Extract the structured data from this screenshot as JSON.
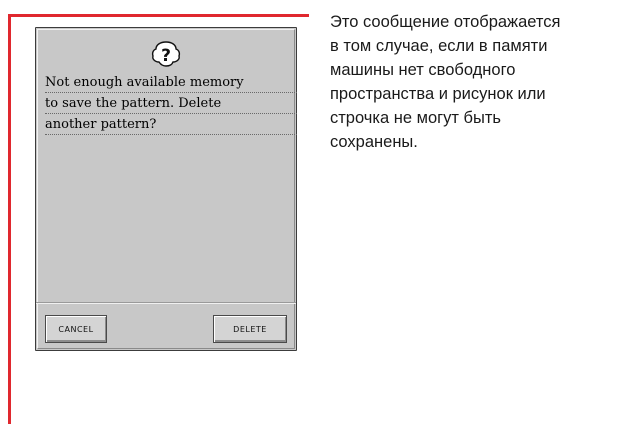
{
  "dialog": {
    "icon": "question-mark-icon",
    "message_lines": [
      "Not enough available memory",
      "to save the pattern. Delete",
      "another pattern?"
    ],
    "cancel_label": "CANCEL",
    "delete_label": "DELETE"
  },
  "description": {
    "lines": [
      "Это сообщение отображается",
      "в том случае, если в памяти",
      "машины нет свободного",
      "пространства и рисунок или",
      "строчка не могут быть",
      "сохранены."
    ]
  },
  "colors": {
    "accent_border": "#e0282e",
    "screen_background": "#c8c8c8"
  }
}
